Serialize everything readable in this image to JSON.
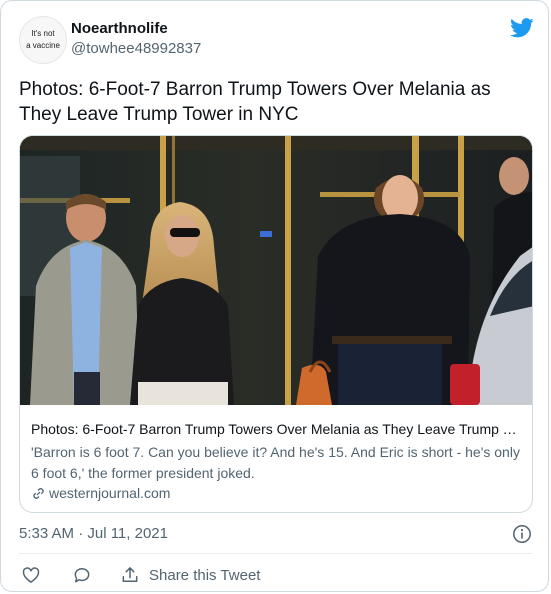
{
  "author": {
    "avatar_line1": "It's not",
    "avatar_line2": "a vaccine",
    "display_name": "Noearthnolife",
    "handle": "@towhee48992837"
  },
  "tweet": {
    "text": "Photos: 6-Foot-7 Barron Trump Towers Over Melania as They Leave Trump Tower in NYC",
    "timestamp": "5:33 AM · Jul 11, 2021"
  },
  "link_card": {
    "title": "Photos: 6-Foot-7 Barron Trump Towers Over Melania as They Leave Trump Tower in NYC",
    "description": "'Barron is 6 foot 7. Can you believe it? And he's 15. And Eric is short - he's only 6 foot 6,' the former president joked.",
    "domain": "westernjournal.com",
    "image_icon": "street-photo-image"
  },
  "actions": {
    "like_icon": "heart-icon",
    "reply_icon": "comment-icon",
    "share_icon": "share-icon",
    "share_label": "Share this Tweet"
  },
  "colors": {
    "twitter_blue": "#1d9bf0",
    "secondary_text": "#536471",
    "border": "#cfd9de"
  }
}
